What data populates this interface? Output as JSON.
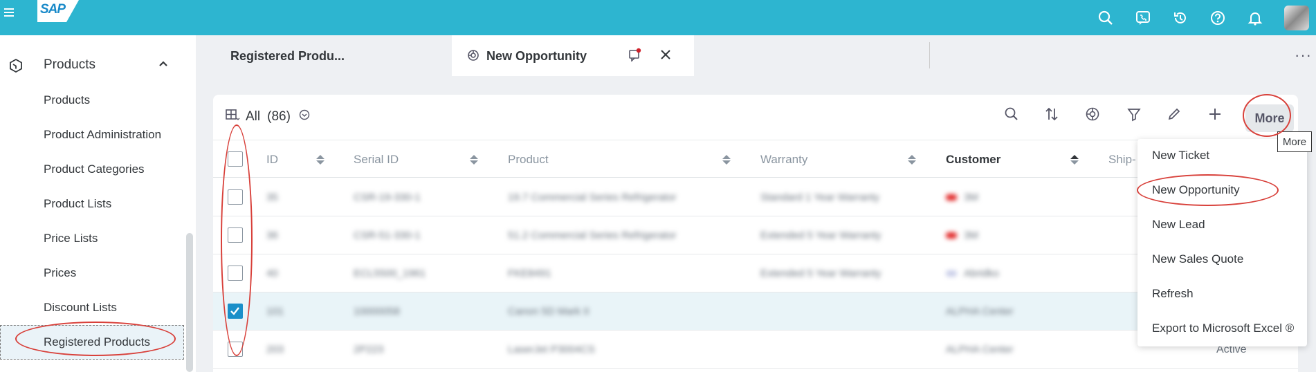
{
  "shell": {
    "logo_text": "SAP",
    "icons": [
      "search-icon",
      "phone-chat-icon",
      "history-icon",
      "help-icon",
      "notification-bell-icon"
    ]
  },
  "sidebar": {
    "section_label": "Products",
    "items": [
      {
        "label": "Products"
      },
      {
        "label": "Product Administration"
      },
      {
        "label": "Product Categories"
      },
      {
        "label": "Product Lists"
      },
      {
        "label": "Price Lists"
      },
      {
        "label": "Prices"
      },
      {
        "label": "Discount Lists"
      },
      {
        "label": "Registered Products"
      }
    ]
  },
  "tabs": {
    "tab1_label": "Registered Produ...",
    "tab2_label": "New Opportunity",
    "more_label": "···"
  },
  "toolbar": {
    "view_label": "All",
    "count": "(86)",
    "more_label": "More"
  },
  "table": {
    "columns": [
      {
        "label": "ID"
      },
      {
        "label": "Serial ID"
      },
      {
        "label": "Product"
      },
      {
        "label": "Warranty"
      },
      {
        "label": "Customer"
      },
      {
        "label": "Ship-"
      }
    ],
    "rows": [
      {
        "id": "35",
        "serial": "CSR-19-330-1",
        "product": "19.7 Commercial Series Refrigerator",
        "warranty": "Standard 1 Year Warranty",
        "customer": "3M",
        "checked": false
      },
      {
        "id": "36",
        "serial": "CSR-51-330-1",
        "product": "51.2 Commercial Series Refrigerator",
        "warranty": "Extended 5 Year Warranty",
        "customer": "3M",
        "checked": false
      },
      {
        "id": "40",
        "serial": "ECL5500_1961",
        "product": "FKE8491",
        "warranty": "Extended 5 Year Warranty",
        "customer": "Abridko",
        "checked": false
      },
      {
        "id": "101",
        "serial": "10000058",
        "product": "Canon 5D Mark II",
        "warranty": "",
        "customer": "ALPHA Center",
        "checked": true
      },
      {
        "id": "203",
        "serial": "2P223",
        "product": "LaserJet P3004CS",
        "warranty": "",
        "customer": "ALPHA Center",
        "checked": false,
        "status": "Active"
      }
    ]
  },
  "menu": {
    "items": [
      {
        "label": "New Ticket"
      },
      {
        "label": "New Opportunity"
      },
      {
        "label": "New Lead"
      },
      {
        "label": "New Sales Quote"
      },
      {
        "label": "Refresh"
      },
      {
        "label": "Export to Microsoft Excel ®"
      }
    ],
    "tooltip": "More"
  },
  "colors": {
    "shell": "#2db5d0",
    "accent": "#1a8fc9",
    "highlight_ring": "#d8403a"
  }
}
